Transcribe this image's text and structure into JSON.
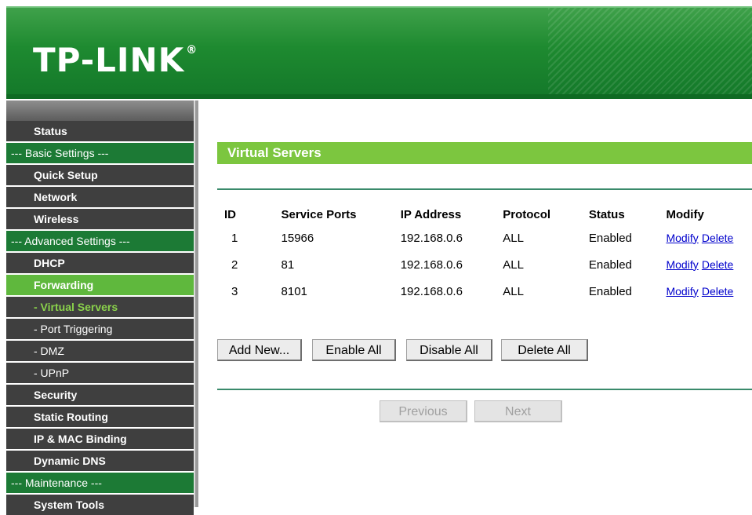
{
  "brand": {
    "logo_text": "TP-LINK",
    "logo_mark": "®",
    "header_color": "#1e8a30"
  },
  "sidebar": {
    "items": [
      {
        "label": "Status",
        "kind": "item"
      },
      {
        "label": "--- Basic Settings ---",
        "kind": "section"
      },
      {
        "label": "Quick Setup",
        "kind": "item"
      },
      {
        "label": "Network",
        "kind": "item"
      },
      {
        "label": "Wireless",
        "kind": "item"
      },
      {
        "label": "--- Advanced Settings ---",
        "kind": "section"
      },
      {
        "label": "DHCP",
        "kind": "item"
      },
      {
        "label": "Forwarding",
        "kind": "active"
      },
      {
        "label": "- Virtual Servers",
        "kind": "sub-current"
      },
      {
        "label": "- Port Triggering",
        "kind": "sub"
      },
      {
        "label": "- DMZ",
        "kind": "sub"
      },
      {
        "label": "- UPnP",
        "kind": "sub"
      },
      {
        "label": "Security",
        "kind": "item"
      },
      {
        "label": "Static Routing",
        "kind": "item"
      },
      {
        "label": "IP & MAC Binding",
        "kind": "item"
      },
      {
        "label": "Dynamic DNS",
        "kind": "item"
      },
      {
        "label": "--- Maintenance ---",
        "kind": "section"
      },
      {
        "label": "System Tools",
        "kind": "item"
      }
    ]
  },
  "main": {
    "title": "Virtual Servers",
    "table": {
      "headers": [
        "ID",
        "Service Ports",
        "IP Address",
        "Protocol",
        "Status",
        "Modify"
      ],
      "rows": [
        {
          "id": "1",
          "ports": "15966",
          "ip": "192.168.0.6",
          "protocol": "ALL",
          "status": "Enabled",
          "modify": "Modify",
          "delete": "Delete"
        },
        {
          "id": "2",
          "ports": "81",
          "ip": "192.168.0.6",
          "protocol": "ALL",
          "status": "Enabled",
          "modify": "Modify",
          "delete": "Delete"
        },
        {
          "id": "3",
          "ports": "8101",
          "ip": "192.168.0.6",
          "protocol": "ALL",
          "status": "Enabled",
          "modify": "Modify",
          "delete": "Delete"
        }
      ]
    },
    "buttons": {
      "add_new": "Add New...",
      "enable_all": "Enable All",
      "disable_all": "Disable All",
      "delete_all": "Delete All",
      "previous": "Previous",
      "next": "Next"
    }
  }
}
